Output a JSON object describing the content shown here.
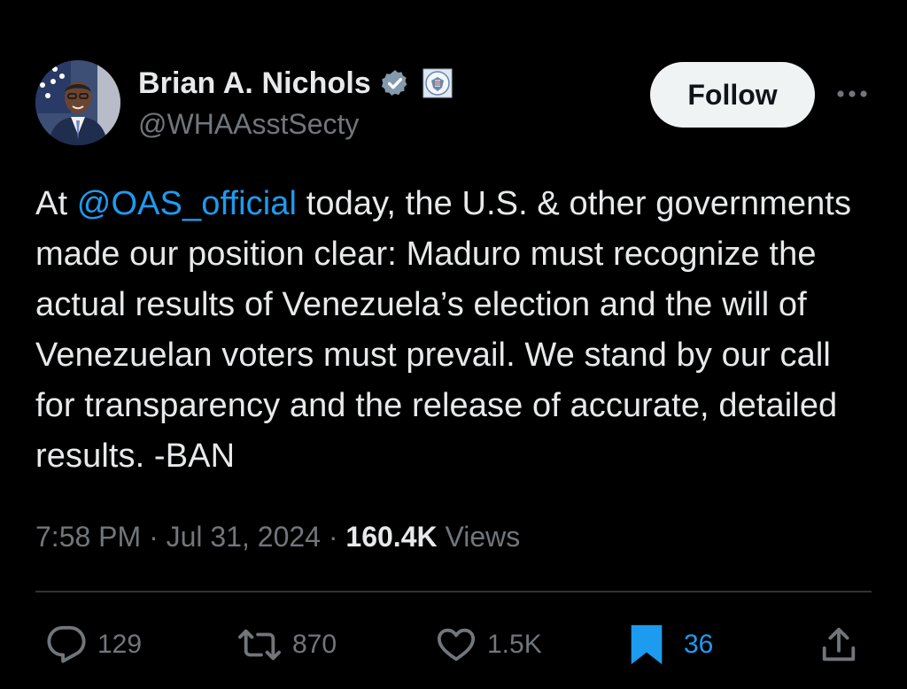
{
  "colors": {
    "background": "#000000",
    "text_primary": "#e7e9ea",
    "text_secondary": "#71767b",
    "link": "#1d9bf0",
    "follow_button_bg": "#eff3f4",
    "divider": "#2f3336"
  },
  "author": {
    "name": "Brian A. Nichols",
    "handle": "@WHAAsstSecty",
    "verified_icon": "verified-badge-icon",
    "affiliation_icon": "us-state-department-seal-icon",
    "avatar_icon": "profile-photo-avatar"
  },
  "header": {
    "follow_label": "Follow",
    "more_icon": "more-horizontal-icon"
  },
  "tweet": {
    "prefix": "At ",
    "mention": "@OAS_official",
    "body": " today, the U.S. & other governments made our position clear: Maduro must recognize the actual results of Venezuela’s election and the will of Venezuelan voters must prevail. We stand by our call for transparency and the release of accurate, detailed results. -BAN"
  },
  "meta": {
    "time": "7:58 PM",
    "separator": " · ",
    "date": "Jul 31, 2024",
    "views_count": "160.4K",
    "views_label": " Views"
  },
  "actions": {
    "reply": {
      "icon": "reply-icon",
      "count": "129"
    },
    "repost": {
      "icon": "repost-icon",
      "count": "870"
    },
    "like": {
      "icon": "heart-icon",
      "count": "1.5K"
    },
    "bookmark": {
      "icon": "bookmark-filled-icon",
      "count": "36",
      "active": true
    },
    "share": {
      "icon": "share-icon"
    }
  }
}
